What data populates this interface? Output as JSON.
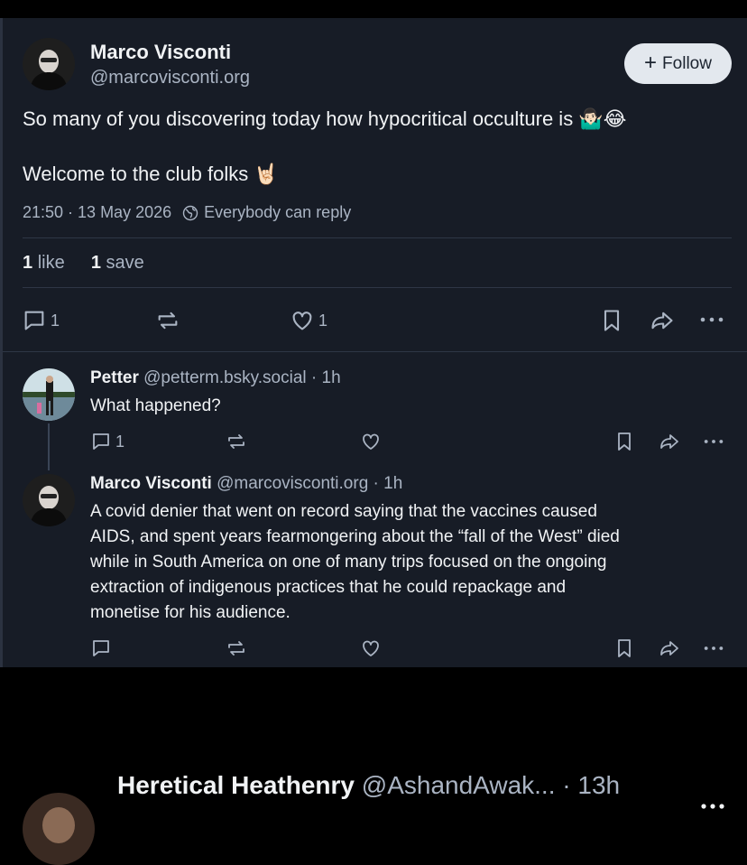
{
  "post": {
    "author_name": "Marco Visconti",
    "author_handle": "@marcovisconti.org",
    "follow_label": "Follow",
    "text_line1": "So many of you discovering today how hypocritical occulture is 🤷🏻‍♂️😂",
    "text_line2": "Welcome to the club folks 🤘🏻",
    "timestamp": "21:50 · 13 May 2026",
    "reply_setting": "Everybody can reply",
    "likes_count": "1",
    "likes_label": "like",
    "saves_count": "1",
    "saves_label": "save",
    "reply_count": "1",
    "like_count": "1"
  },
  "replies": [
    {
      "name": "Petter",
      "handle_time": "@petterm.bsky.social · 1h",
      "text": "What happened?",
      "reply_count": "1"
    },
    {
      "name": "Marco Visconti",
      "handle_time": "@marcovisconti.org · 1h",
      "lines": [
        "A covid denier that went on record saying that the vaccines caused",
        "AIDS, and spent years fearmongering about the “fall of the West” died",
        "while in South America on one of many trips focused on the ongoing",
        "extraction of indigenous practices that he could repackage and",
        "monetise for his audience."
      ]
    }
  ],
  "next_post": {
    "name": "Heretical Heathenry",
    "handle_time": "@AshandAwak... · 13h"
  },
  "colors": {
    "panel_bg": "#171c26",
    "text_primary": "#f1f3f5",
    "text_secondary": "#aab4c3",
    "follow_bg": "#e3e8ee"
  },
  "icons": [
    "comment-icon",
    "repost-icon",
    "heart-icon",
    "bookmark-icon",
    "share-icon",
    "more-icon",
    "globe-icon",
    "plus-icon"
  ]
}
